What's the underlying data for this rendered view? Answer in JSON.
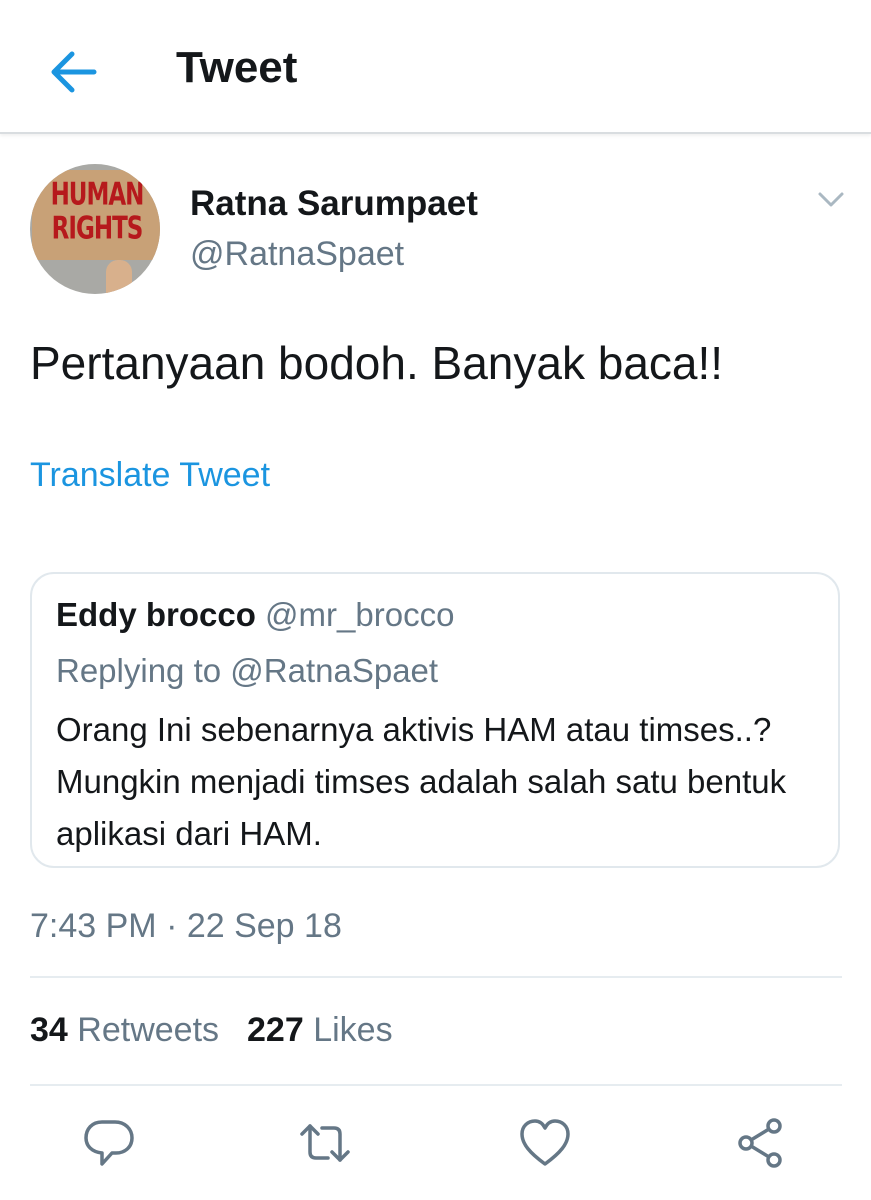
{
  "header": {
    "title": "Tweet",
    "back_icon": "arrow-left-icon"
  },
  "colors": {
    "accent": "#1b95e0",
    "muted_text": "#657786",
    "primary_text": "#14171a",
    "border": "#e1e8ed"
  },
  "tweet": {
    "avatar": {
      "line1": "HUMAN",
      "line2": "RIGHTS"
    },
    "display_name": "Ratna Sarumpaet",
    "handle": "@RatnaSpaet",
    "text": "Pertanyaan bodoh. Banyak baca!!",
    "translate_label": "Translate Tweet",
    "menu_icon": "chevron-down-icon"
  },
  "quoted_tweet": {
    "display_name": "Eddy brocco",
    "handle": "@mr_brocco",
    "replying_to": "Replying to @RatnaSpaet",
    "text": "Orang Ini sebenarnya aktivis HAM atau timses..? Mungkin menjadi timses adalah salah satu bentuk aplikasi dari HAM."
  },
  "meta": {
    "timestamp": "7:43 PM · 22 Sep 18"
  },
  "stats": {
    "retweets_count": "34",
    "retweets_label": "Retweets",
    "likes_count": "227",
    "likes_label": "Likes"
  },
  "actions": [
    {
      "name": "reply",
      "icon": "reply-icon"
    },
    {
      "name": "retweet",
      "icon": "retweet-icon"
    },
    {
      "name": "like",
      "icon": "heart-icon"
    },
    {
      "name": "share",
      "icon": "share-icon"
    }
  ]
}
